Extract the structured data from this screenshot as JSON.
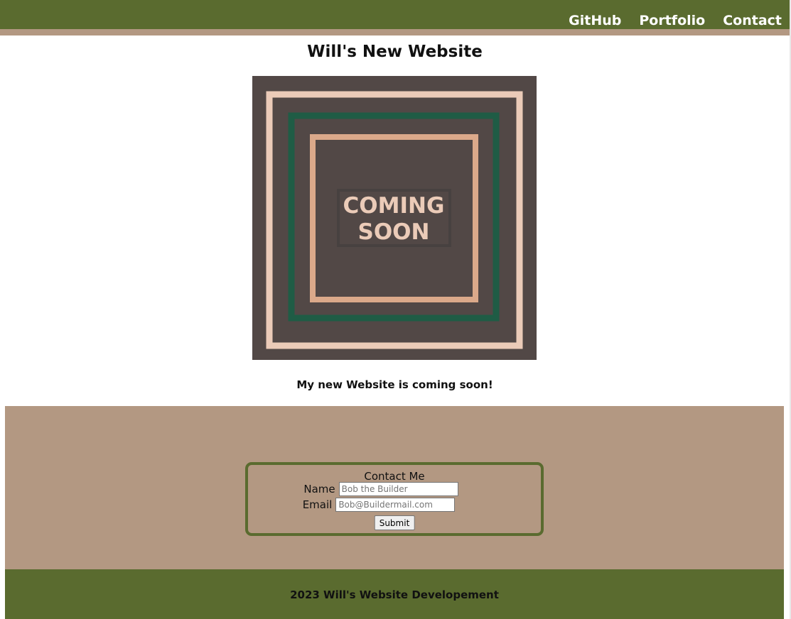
{
  "nav": {
    "links": [
      "GitHub",
      "Portfolio",
      "Contact"
    ]
  },
  "header": {
    "title": "Will's New Website"
  },
  "hero": {
    "line1": "COMING",
    "line2": "SOON"
  },
  "tagline": "My new Website is coming soon!",
  "contact": {
    "heading": "Contact Me",
    "name_label": "Name",
    "name_placeholder": "Bob the Builder",
    "email_label": "Email",
    "email_placeholder": "Bob@Buildermail.com",
    "submit_label": "Submit"
  },
  "footer": {
    "text": "2023 Will's Website Developement"
  },
  "colors": {
    "nav_green": "#5a6b2f",
    "tan": "#b39882",
    "hero_bg": "#524846",
    "hero_pale": "#ebcbb8",
    "hero_green": "#1f5c45",
    "hero_peach": "#dba98a"
  }
}
